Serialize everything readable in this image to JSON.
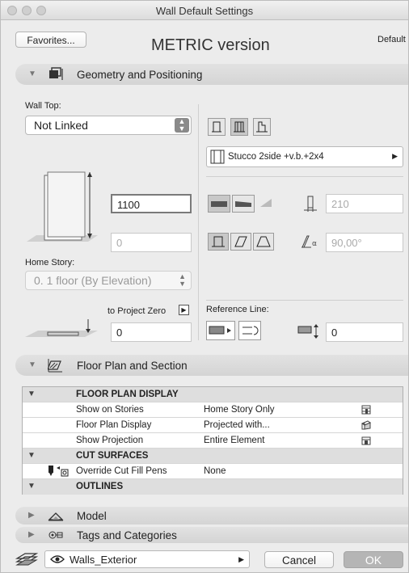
{
  "window": {
    "title": "Wall Default Settings"
  },
  "header": {
    "favorites_label": "Favorites...",
    "version_label": "METRIC version",
    "default_label": "Default"
  },
  "sections": {
    "geometry": "Geometry and Positioning",
    "floor_plan": "Floor Plan and Section",
    "model": "Model",
    "tags": "Tags and Categories"
  },
  "geometry": {
    "wall_top_label": "Wall Top:",
    "wall_top_value": "Not Linked",
    "height_value": "1100",
    "bottom_offset_value": "0",
    "home_story_label": "Home Story:",
    "home_story_value": "0. 1 floor (By Elevation)",
    "to_project_zero_label": "to Project Zero",
    "project_zero_value": "0",
    "composite_value": "Stucco 2side +v.b.+2x4",
    "thickness_value": "210",
    "angle_value": "90,00°",
    "reference_line_label": "Reference Line:",
    "reference_offset_value": "0"
  },
  "floor_plan_table": {
    "groups": [
      {
        "title": "FLOOR PLAN DISPLAY"
      },
      {
        "title": "CUT SURFACES"
      },
      {
        "title": "OUTLINES"
      }
    ],
    "rows": [
      {
        "name": "Show on Stories",
        "value": "Home Story Only"
      },
      {
        "name": "Floor Plan Display",
        "value": "Projected with..."
      },
      {
        "name": "Show Projection",
        "value": "Entire Element"
      },
      {
        "name": "Override Cut Fill Pens",
        "value": "None"
      }
    ]
  },
  "footer": {
    "layer_value": "Walls_Exterior",
    "cancel_label": "Cancel",
    "ok_label": "OK"
  }
}
